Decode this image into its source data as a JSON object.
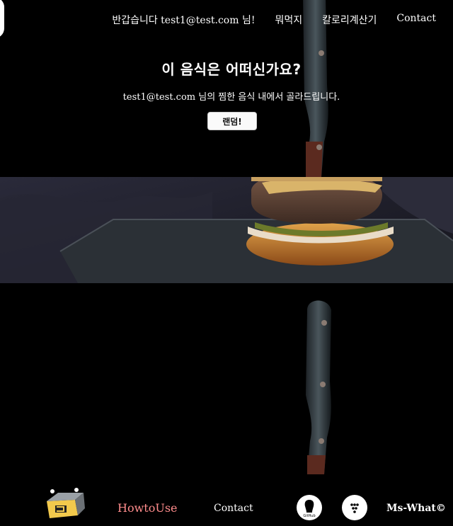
{
  "nav": {
    "greeting": "반갑습니다 test1@test.com 님!",
    "items": [
      "뭐먹지",
      "칼로리계산기",
      "Contact"
    ]
  },
  "hero": {
    "title": "이 음식은 어떠신가요?",
    "subtitle": "test1@test.com 님의 찜한 음식 내에서 골라드립니다.",
    "button": "랜덤!"
  },
  "footer": {
    "howto": "HowtoUse",
    "contact": "Contact",
    "github_label": "GitHub",
    "copyright": "Ms-What©"
  },
  "colors": {
    "background": "#000000",
    "howto_link": "#ff8c8c",
    "button_bg": "#fafafa"
  },
  "icons": [
    "logo",
    "knife",
    "github-icon",
    "dots-icon",
    "food-box-logo"
  ]
}
